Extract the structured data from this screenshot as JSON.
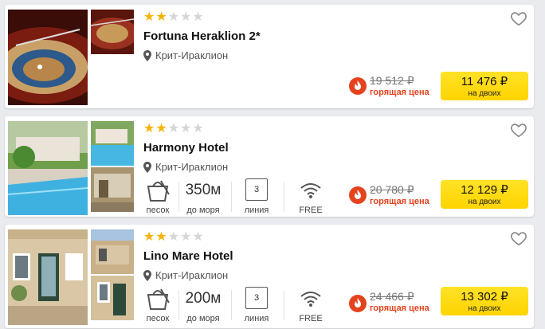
{
  "hotels": [
    {
      "name": "Fortuna Heraklion 2*",
      "location": "Крит-Ираклион",
      "stars": 2,
      "old_price": "19 512 ₽",
      "hot_label": "горящая цена",
      "price": "11 476 ₽",
      "price_note": "на двоих",
      "photo_icon": "roulette-photo",
      "amenities": []
    },
    {
      "name": "Harmony Hotel",
      "location": "Крит-Ираклион",
      "stars": 2,
      "old_price": "20 780 ₽",
      "hot_label": "горящая цена",
      "price": "12 129 ₽",
      "price_note": "на двоих",
      "photo_icon": "pool-photo",
      "amenities": {
        "beach_label": "песок",
        "distance_value": "350м",
        "distance_label": "до моря",
        "line_value": "3",
        "line_label": "линия",
        "wifi_label": "FREE"
      }
    },
    {
      "name": "Lino Mare Hotel",
      "location": "Крит-Ираклион",
      "stars": 2,
      "old_price": "24 466 ₽",
      "hot_label": "горящая цена",
      "price": "13 302 ₽",
      "price_note": "на двоих",
      "photo_icon": "building-photo",
      "amenities": {
        "beach_label": "песок",
        "distance_value": "200м",
        "distance_label": "до моря",
        "line_value": "3",
        "line_label": "линия",
        "wifi_label": "FREE"
      }
    }
  ],
  "colors": {
    "accent": "#ffd400",
    "hot": "#e5421e",
    "star": "#f5b400"
  }
}
